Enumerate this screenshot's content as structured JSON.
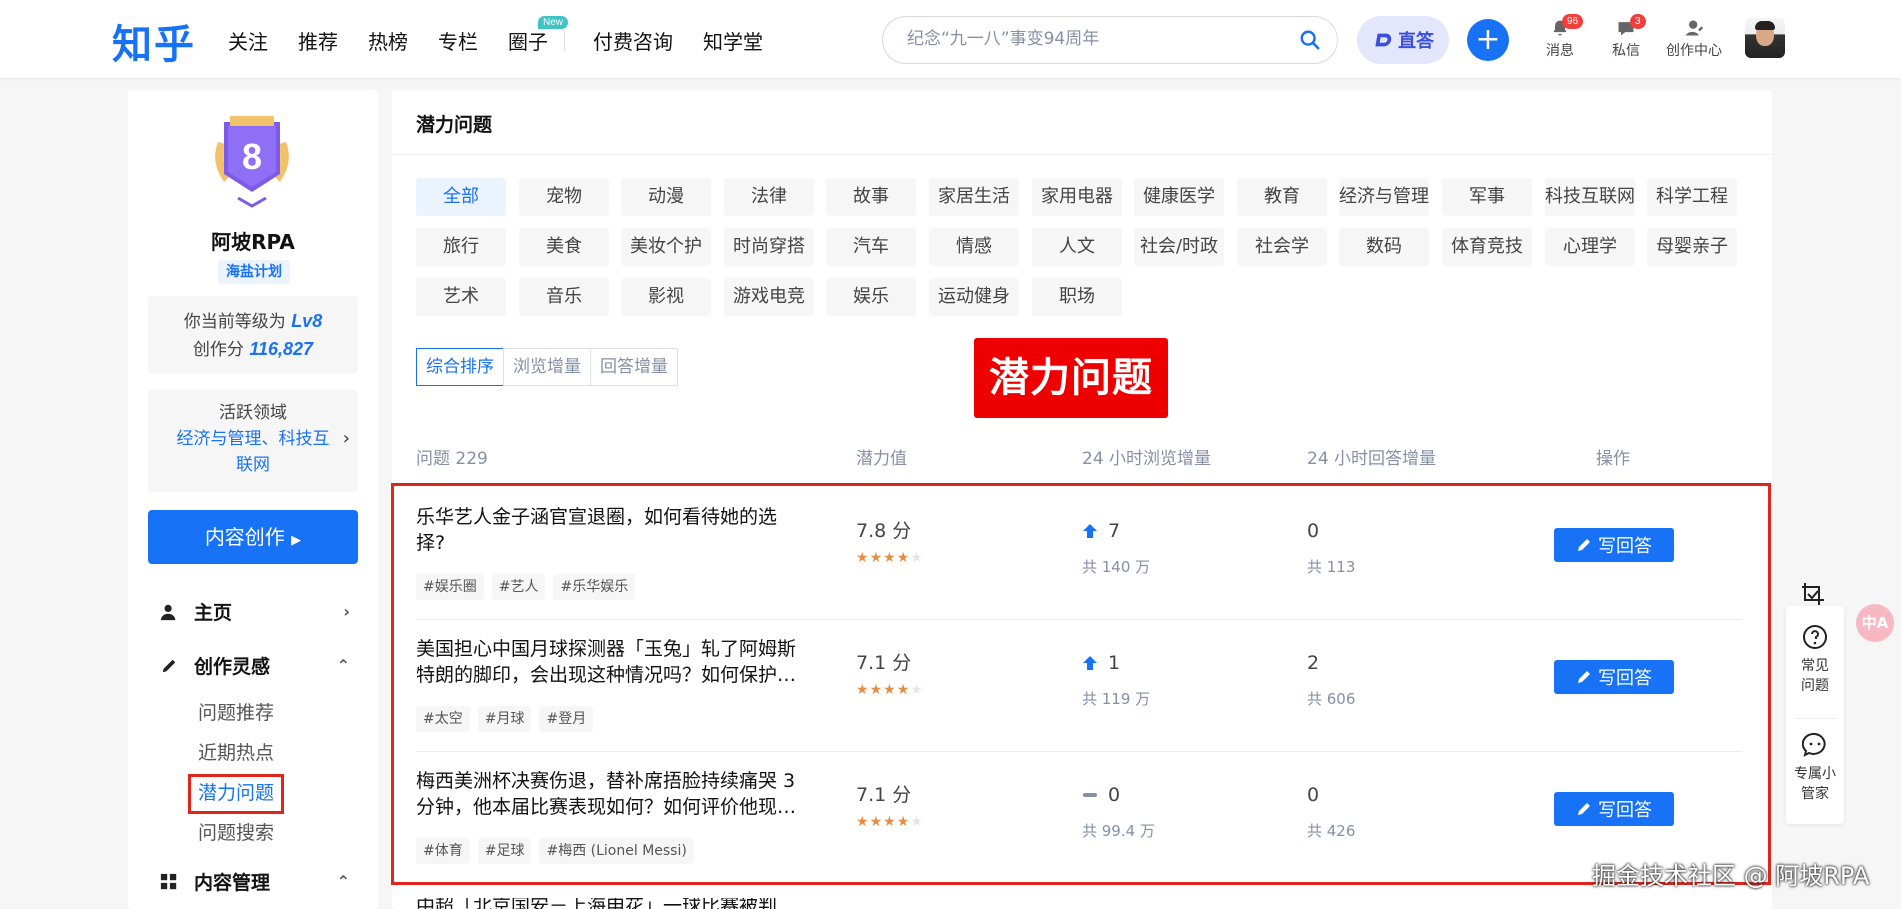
{
  "header": {
    "logo": "知乎",
    "nav": [
      "关注",
      "推荐",
      "热榜",
      "专栏",
      "圈子"
    ],
    "nav_new_badge": "New",
    "nav_extra": [
      "付费咨询",
      "知学堂"
    ],
    "search_placeholder": "纪念“九一八”事变94周年",
    "zhida_label": "直答",
    "messages_label": "消息",
    "messages_count": "96",
    "inbox_label": "私信",
    "inbox_count": "3",
    "creator_label": "创作中心"
  },
  "sidebar": {
    "level_number": "8",
    "user_name": "阿坡RPA",
    "plan_badge": "海盐计划",
    "level_prefix": "你当前等级为",
    "level_value": "Lv8",
    "score_prefix": "创作分",
    "score_value": "116,827",
    "domain_title": "活跃领域",
    "domain_value": "经济与管理、科技互联网",
    "create_button": "内容创作",
    "menu_home": "主页",
    "menu_inspiration": "创作灵感",
    "sub_items": [
      "问题推荐",
      "近期热点",
      "潜力问题",
      "问题搜索"
    ],
    "menu_content": "内容管理"
  },
  "main": {
    "title": "潜力问题",
    "tags": [
      "全部",
      "宠物",
      "动漫",
      "法律",
      "故事",
      "家居生活",
      "家用电器",
      "健康医学",
      "教育",
      "经济与管理",
      "军事",
      "科技互联网",
      "科学工程",
      "旅行",
      "美食",
      "美妆个护",
      "时尚穿搭",
      "汽车",
      "情感",
      "人文",
      "社会/时政",
      "社会学",
      "数码",
      "体育竞技",
      "心理学",
      "母婴亲子",
      "艺术",
      "音乐",
      "影视",
      "游戏电竞",
      "娱乐",
      "运动健身",
      "职场"
    ],
    "sort_options": [
      "综合排序",
      "浏览增量",
      "回答增量"
    ],
    "overlay_label": "潜力问题",
    "columns": {
      "question": "问题 229",
      "potential": "潜力值",
      "views": "24 小时浏览增量",
      "answers": "24 小时回答增量",
      "action": "操作"
    },
    "rows": [
      {
        "title": "乐华艺人金子涵官宣退圈，如何看待她的选择?",
        "tags": [
          "#娱乐圈",
          "#艺人",
          "#乐华娱乐"
        ],
        "score": "7.8 分",
        "stars": 4,
        "view_trend": "up",
        "views_delta": "7",
        "views_total": "共 140 万",
        "answers_delta": "0",
        "answers_total": "共 113",
        "action": "写回答"
      },
      {
        "title": "美国担心中国月球探测器「玉兔」轧了阿姆斯特朗的脚印，会出现这种情况吗？如何保护…",
        "tags": [
          "#太空",
          "#月球",
          "#登月"
        ],
        "score": "7.1 分",
        "stars": 4,
        "view_trend": "up",
        "views_delta": "1",
        "views_total": "共 119 万",
        "answers_delta": "2",
        "answers_total": "共 606",
        "action": "写回答"
      },
      {
        "title": "梅西美洲杯决赛伤退，替补席捂脸持续痛哭 3 分钟，他本届比赛表现如何？如何评价他现…",
        "tags": [
          "#体育",
          "#足球",
          "#梅西 (Lionel Messi)"
        ],
        "score": "7.1 分",
        "stars": 4,
        "view_trend": "flat",
        "views_delta": "0",
        "views_total": "共 99.4 万",
        "answers_delta": "0",
        "answers_total": "共 426",
        "action": "写回答"
      }
    ],
    "cut_row_text": "中超「北京国安－上海申花」一球比赛被判…"
  },
  "float_panel": {
    "faq": "常见问题",
    "assistant": "专属小管家",
    "translate": "中A"
  },
  "watermark": "掘金技术社区 @ 阿坡RPA",
  "colors": {
    "brand": "#1772f6",
    "highlight_red": "#e1251b",
    "star": "#e88d3f"
  }
}
